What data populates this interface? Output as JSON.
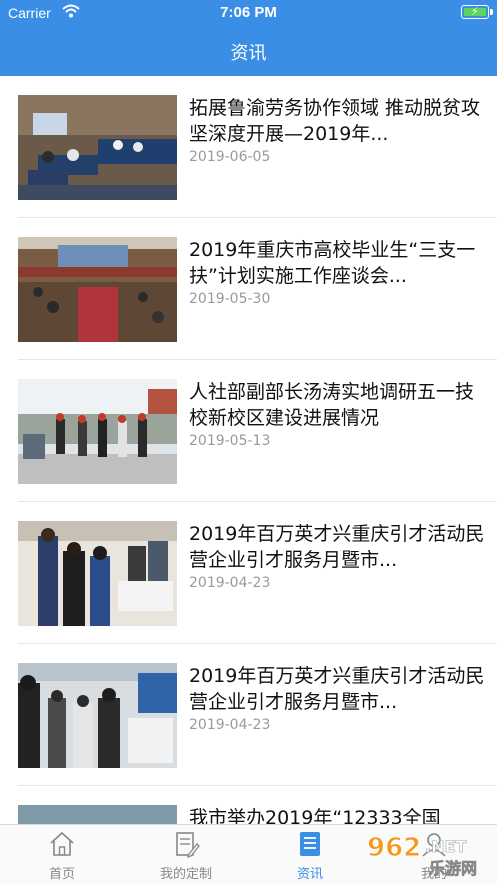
{
  "status": {
    "carrier": "Carrier",
    "time": "7:06 PM"
  },
  "nav": {
    "title": "资讯"
  },
  "articles": [
    {
      "title": "拓展鲁渝劳务协作领域 推动脱贫攻坚深度开展—2019年...",
      "date": "2019-06-05"
    },
    {
      "title": "2019年重庆市高校毕业生“三支一扶”计划实施工作座谈会...",
      "date": "2019-05-30"
    },
    {
      "title": "人社部副部长汤涛实地调研五一技校新校区建设进展情况",
      "date": "2019-05-13"
    },
    {
      "title": "2019年百万英才兴重庆引才活动民营企业引才服务月暨市...",
      "date": "2019-04-23"
    },
    {
      "title": "2019年百万英才兴重庆引才活动民营企业引才服务月暨市...",
      "date": "2019-04-23"
    },
    {
      "title": "我市举办2019年“12333全国",
      "date": ""
    }
  ],
  "tabs": [
    {
      "label": "首页",
      "icon": "home-icon"
    },
    {
      "label": "我的定制",
      "icon": "edit-doc-icon"
    },
    {
      "label": "资讯",
      "icon": "news-icon",
      "active": true
    },
    {
      "label": "我的",
      "icon": "user-icon"
    }
  ],
  "watermark": {
    "brand": "962.NET",
    "sub": "乐游网"
  },
  "colors": {
    "accent": "#3a8ee6",
    "inactive": "#888888"
  }
}
